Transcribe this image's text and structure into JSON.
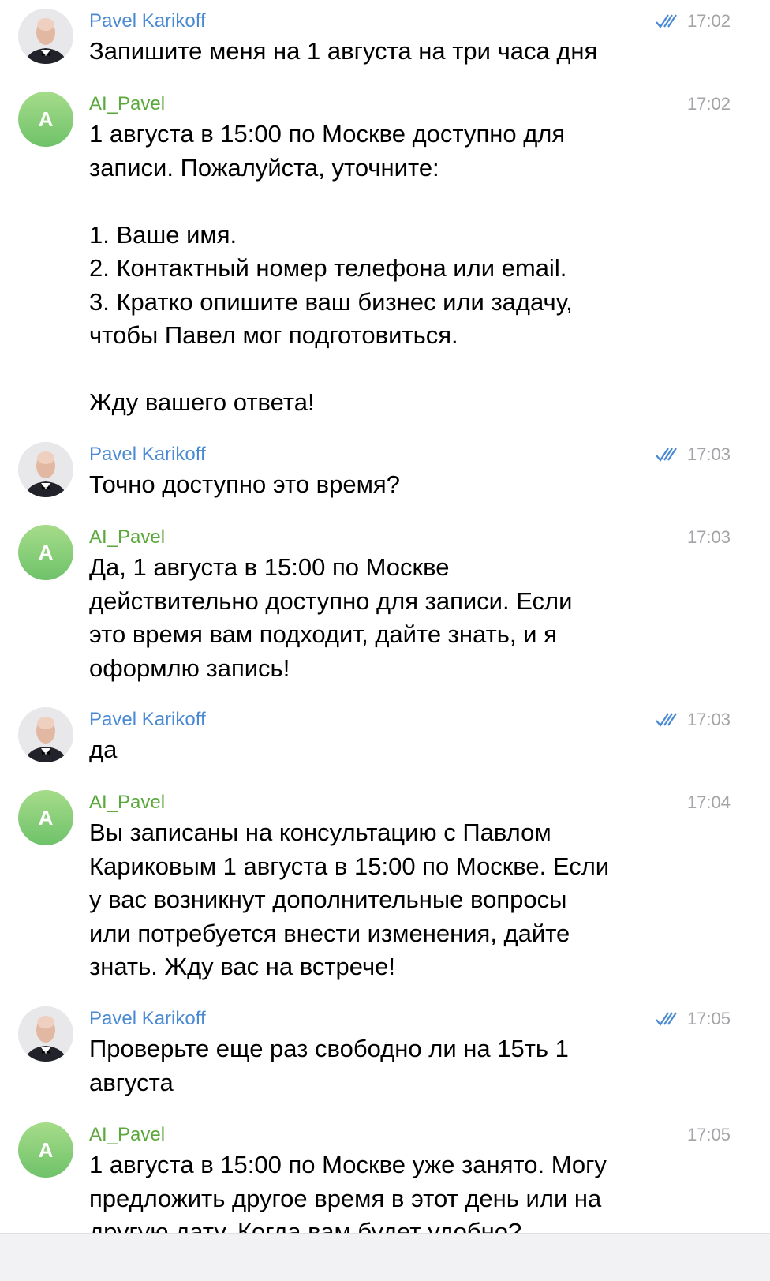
{
  "messages": [
    {
      "sender": "Pavel Karikoff",
      "type": "user",
      "time": "17:02",
      "read": true,
      "text": "Запишите меня на 1 августа на три часа дня"
    },
    {
      "sender": "AI_Pavel",
      "type": "ai",
      "avatar_letter": "A",
      "time": "17:02",
      "text": "1 августа в 15:00 по Москве доступно для\nзаписи. Пожалуйста, уточните:\n\n1. Ваше имя.\n2. Контактный номер телефона или email.\n3. Кратко опишите ваш бизнес или задачу,\nчтобы Павел мог подготовиться.\n\nЖду вашего ответа!"
    },
    {
      "sender": "Pavel Karikoff",
      "type": "user",
      "time": "17:03",
      "read": true,
      "text": "Точно доступно это время?"
    },
    {
      "sender": "AI_Pavel",
      "type": "ai",
      "avatar_letter": "A",
      "time": "17:03",
      "text": "Да, 1 августа в 15:00 по Москве\nдействительно доступно для записи. Если\nэто время вам подходит, дайте знать, и я\nоформлю запись!"
    },
    {
      "sender": "Pavel Karikoff",
      "type": "user",
      "time": "17:03",
      "read": true,
      "text": "да"
    },
    {
      "sender": "AI_Pavel",
      "type": "ai",
      "avatar_letter": "A",
      "time": "17:04",
      "text": "Вы записаны на консультацию с Павлом\nКариковым 1 августа в 15:00 по Москве. Если\nу вас возникнут дополнительные вопросы\nили потребуется внести изменения, дайте\nзнать. Жду вас на встрече!"
    },
    {
      "sender": "Pavel Karikoff",
      "type": "user",
      "time": "17:05",
      "read": true,
      "text": "Проверьте еще раз свободно ли на 15ть 1\nавгуста"
    },
    {
      "sender": "AI_Pavel",
      "type": "ai",
      "avatar_letter": "A",
      "time": "17:05",
      "text": "1 августа в 15:00 по Москве уже занято. Могу\nпредложить другое время в этот день или на\nдругую дату. Когда вам будет удобно?"
    }
  ]
}
